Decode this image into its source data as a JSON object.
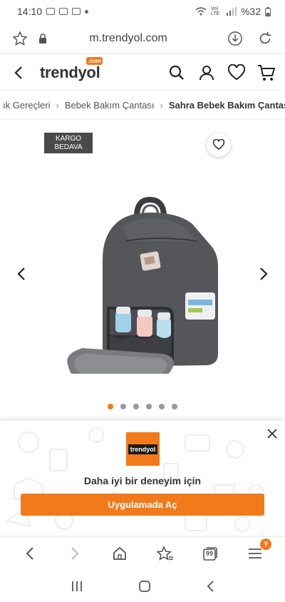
{
  "status_bar": {
    "time": "14:10",
    "battery": "%32",
    "network": "Vo) LTE"
  },
  "browser": {
    "url": "m.trendyol.com"
  },
  "site": {
    "logo": "trendyol",
    "logo_suffix": ".com"
  },
  "breadcrumb": {
    "items": [
      "ık Gereçleri",
      "Bebek Bakım Çantası",
      "Sahra Bebek Bakım Çantası"
    ]
  },
  "product": {
    "badge_line1": "KARGO",
    "badge_line2": "BEDAVA",
    "image_count": 6,
    "active_image": 1
  },
  "app_banner": {
    "logo_text": "trendyol",
    "message": "Daha iyi bir deneyim için",
    "button_label": "Uygulamada Aç"
  },
  "bottom_nav": {
    "tab_count_label": "99",
    "menu_badge": "Y"
  },
  "colors": {
    "brand_orange": "#f27a1a",
    "badge_dark": "#4a4a4a"
  },
  "icons": [
    "star-icon",
    "lock-icon",
    "download-icon",
    "refresh-icon",
    "back-arrow-icon",
    "search-icon",
    "user-icon",
    "heart-icon",
    "cart-icon",
    "close-icon",
    "home-icon",
    "bookmarks-icon",
    "tabs-icon",
    "menu-icon"
  ]
}
